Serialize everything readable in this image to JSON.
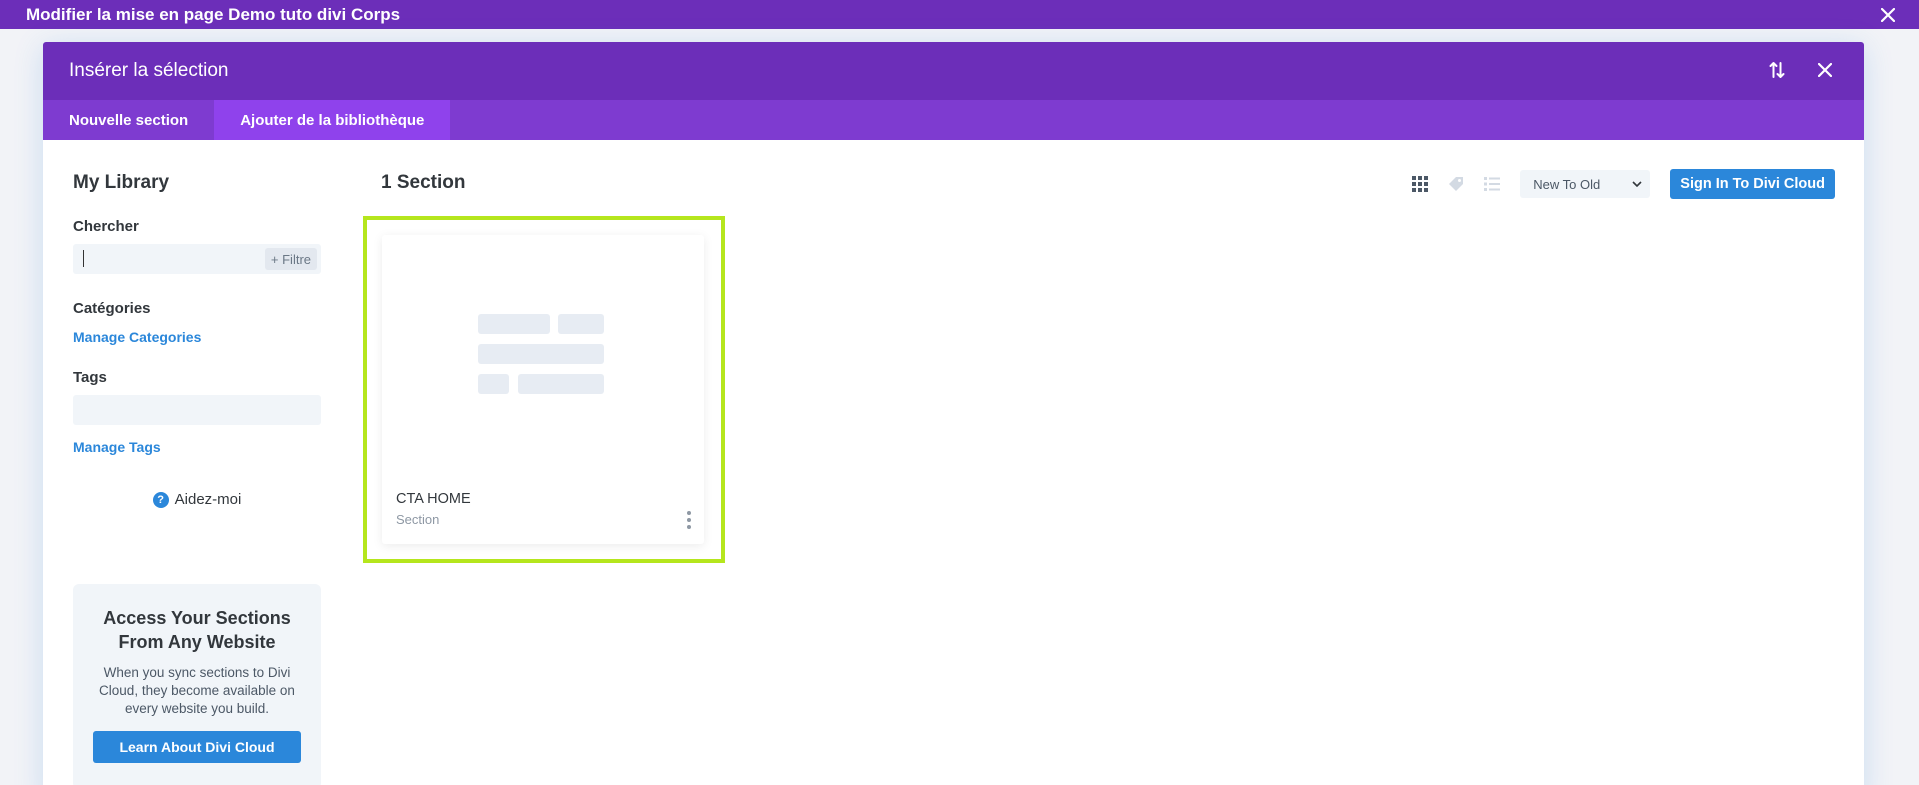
{
  "topbar": {
    "title": "Modifier la mise en page Demo tuto divi Corps"
  },
  "modal": {
    "title": "Insérer la sélection",
    "tabs": [
      {
        "label": "Nouvelle section",
        "active": false
      },
      {
        "label": "Ajouter de la bibliothèque",
        "active": true
      }
    ]
  },
  "sidebar": {
    "library_title": "My Library",
    "search_label": "Chercher",
    "search_value": "",
    "filter_label": "+ Filtre",
    "categories_label": "Catégories",
    "manage_categories": "Manage Categories",
    "tags_label": "Tags",
    "manage_tags": "Manage Tags",
    "help_label": "Aidez-moi",
    "help_icon_glyph": "?",
    "promo": {
      "title": "Access Your Sections From Any Website",
      "text": "When you sync sections to Divi Cloud, they become available on every website you build.",
      "button": "Learn About Divi Cloud"
    }
  },
  "content": {
    "title": "1 Section",
    "sort_value": "New To Old",
    "cloud_button": "Sign In To Divi Cloud",
    "items": [
      {
        "name": "CTA HOME",
        "type": "Section"
      }
    ]
  },
  "colors": {
    "purple_dark": "#6c2eb9",
    "purple_tabs": "#7e3bd0",
    "purple_active": "#8f42ec",
    "blue": "#2b87da",
    "highlight": "#b5e61d"
  }
}
